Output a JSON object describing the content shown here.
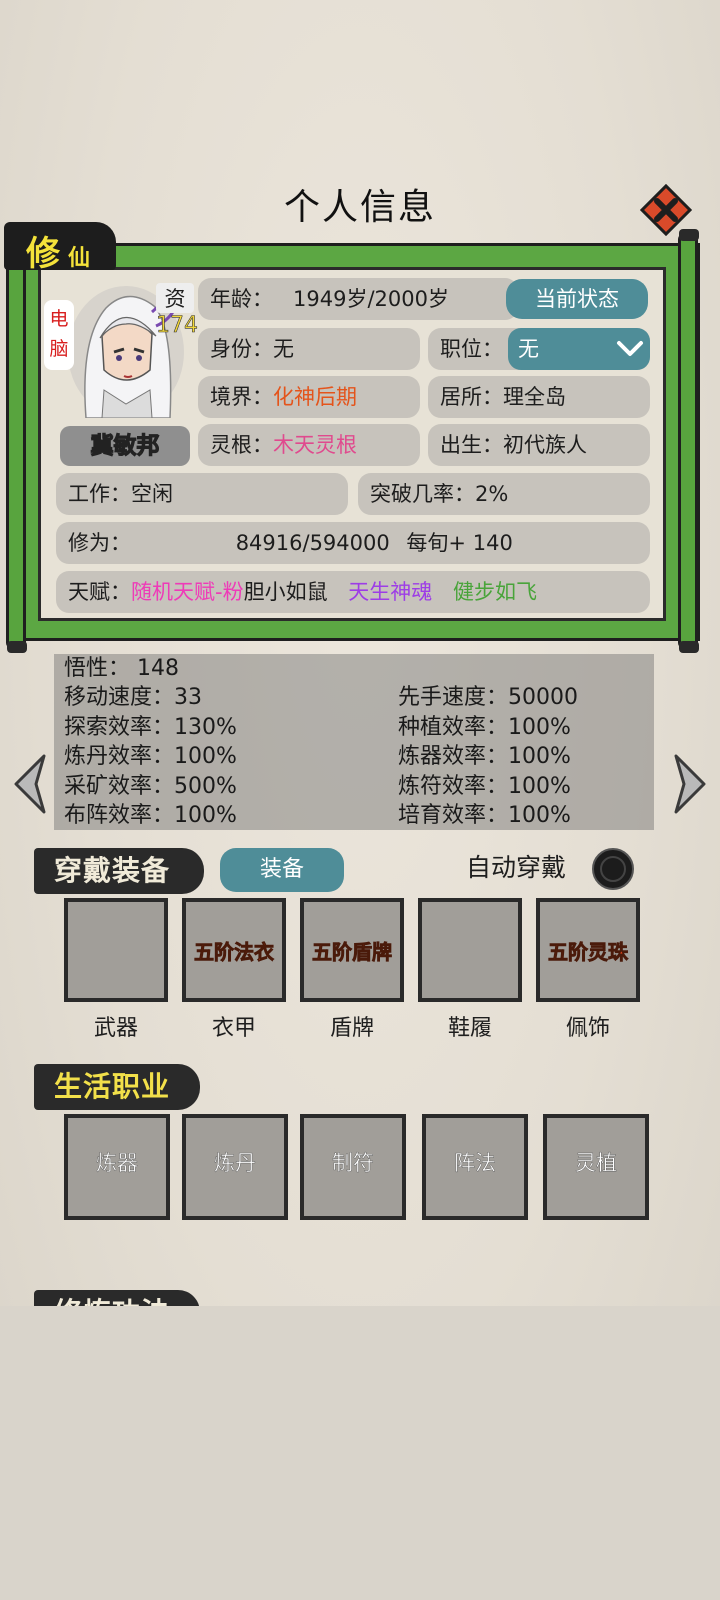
{
  "header": {
    "title": "个人信息"
  },
  "character": {
    "tab_big": "修",
    "tab_small": "仙",
    "player_tag": "电脑",
    "aptitude_label": "资",
    "aptitude_value": "174",
    "name": "冀敏邦"
  },
  "info": {
    "age_label": "年龄：",
    "age_value": "1949岁/2000岁",
    "status_button": "当前状态",
    "identity_label": "身份：",
    "identity_value": "无",
    "position_label": "职位：",
    "position_value": "无",
    "realm_label": "境界：",
    "realm_value": "化神后期",
    "residence_label": "居所：",
    "residence_value": "理全岛",
    "root_label": "灵根：",
    "root_value": "木天灵根",
    "birth_label": "出生：",
    "birth_value": "初代族人",
    "work_label": "工作：",
    "work_value": "空闲",
    "breakthrough_label": "突破几率：",
    "breakthrough_value": "2%",
    "cultivation_label": "修为：",
    "cultivation_value": "84916/594000",
    "per_turn_label": "每旬+",
    "per_turn_value": "140",
    "talent_label": "天赋：",
    "talents": [
      "随机天赋-粉",
      "胆小如鼠",
      "天生神魂",
      "健步如飞"
    ]
  },
  "stats": {
    "comprehension": "悟性： 148",
    "left": [
      "移动速度：33",
      "探索效率：130%",
      "炼丹效率：100%",
      "采矿效率：500%",
      "布阵效率：100%"
    ],
    "right": [
      "先手速度：50000",
      "种植效率：100%",
      "炼器效率：100%",
      "炼符效率：100%",
      "培育效率：100%"
    ]
  },
  "equipment": {
    "section_title": "穿戴装备",
    "equip_button": "装备",
    "auto_wear_label": "自动穿戴",
    "slots": [
      {
        "label": "武器",
        "item": ""
      },
      {
        "label": "衣甲",
        "item": "五阶法衣"
      },
      {
        "label": "盾牌",
        "item": "五阶盾牌"
      },
      {
        "label": "鞋履",
        "item": ""
      },
      {
        "label": "佩饰",
        "item": "五阶灵珠"
      }
    ]
  },
  "professions": {
    "section_title": "生活职业",
    "items": [
      "炼器",
      "炼丹",
      "制符",
      "阵法",
      "灵植"
    ]
  },
  "next_section": {
    "title": "修炼功法"
  },
  "colors": {
    "scroll_green": "#5ca743",
    "teal": "#4f8d98",
    "realm_orange": "#e4541b",
    "root_pink": "#e04a8e",
    "equip_red": "#e0441a"
  }
}
